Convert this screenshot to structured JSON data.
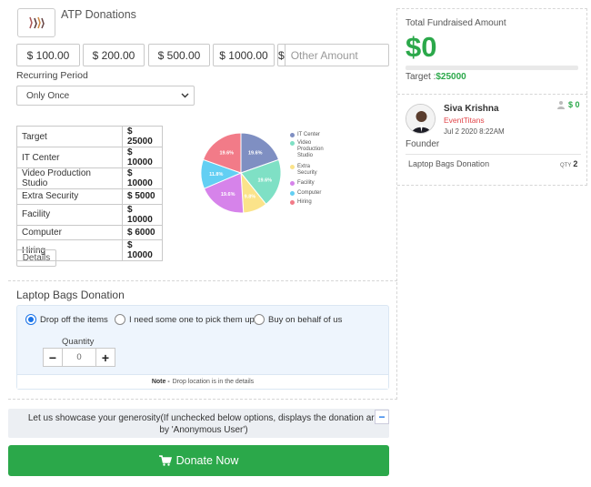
{
  "campaign": {
    "title": "ATP Donations",
    "amounts": [
      "$ 100.00",
      "$ 200.00",
      "$ 500.00",
      "$ 1000.00"
    ],
    "currency_symbol": "$",
    "other_placeholder": "Other Amount",
    "recurring_label": "Recurring Period",
    "recurring_value": "Only Once",
    "details_label": "Details"
  },
  "goals": [
    {
      "label": "Target",
      "value": "$ 25000"
    },
    {
      "label": "IT Center",
      "value": "$ 10000"
    },
    {
      "label": "Video Production Studio",
      "value": "$ 10000"
    },
    {
      "label": "Extra Security",
      "value": "$ 5000"
    },
    {
      "label": "Facility",
      "value": "$ 10000"
    },
    {
      "label": "Computer",
      "value": "$ 6000"
    },
    {
      "label": "Hiring",
      "value": "$ 10000"
    }
  ],
  "chart_data": {
    "type": "pie",
    "categories": [
      "IT Center",
      "Video Production Studio",
      "Extra Security",
      "Facility",
      "Computer",
      "Hiring"
    ],
    "values": [
      19.6,
      19.6,
      9.8,
      19.6,
      11.8,
      19.6
    ],
    "slice_labels": [
      "19.6%",
      "19.6%",
      "9.8%",
      "19.6%",
      "11.8%",
      "19.6%"
    ],
    "colors": [
      "#7f8fc2",
      "#7fe0c5",
      "#fbe38a",
      "#d683ea",
      "#63cff3",
      "#f27b88"
    ],
    "legend_position": "right"
  },
  "item": {
    "title": "Laptop Bags Donation",
    "options": [
      "Drop off the items",
      "I need some one to pick them up",
      "Buy on behalf of us"
    ],
    "selected_option": "Drop off the items",
    "quantity_label": "Quantity",
    "quantity_value": "0",
    "note_label": "Note -",
    "note_text": "Drop location is in the details"
  },
  "showcase_text": "Let us showcase your generosity(If unchecked below options, displays the donation are by 'Anonymous User')",
  "donate_label": "Donate Now",
  "summary": {
    "fund_label": "Total Fundraised Amount",
    "fund_amount": "$0",
    "target_label": "Target :",
    "target_value": "$25000",
    "progress_fraction": 0
  },
  "donor": {
    "name": "Siva Krishna",
    "org": "EventTitans",
    "date": "Jul 2 2020 8:22AM",
    "amount": "$ 0",
    "role": "Founder",
    "item": "Laptop Bags Donation",
    "qty_label": "QTY",
    "qty": "2"
  },
  "colors": {
    "green": "#2ba84a",
    "blue": "#1a73e8",
    "red": "#e2464a"
  }
}
